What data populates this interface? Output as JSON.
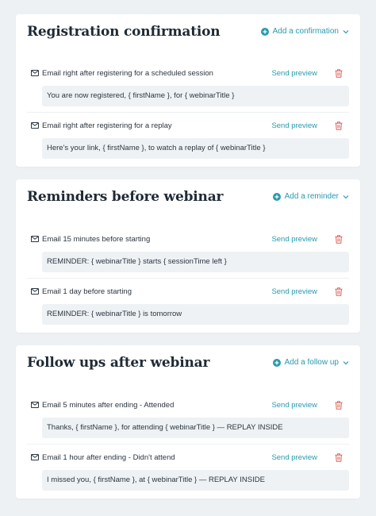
{
  "sections": [
    {
      "title": "Registration confirmation",
      "add_label": "Add a confirmation",
      "emails": [
        {
          "label": "Email right after registering for a scheduled session",
          "preview": "Send preview",
          "subject": "You are now registered, { firstName }, for { webinarTitle }"
        },
        {
          "label": "Email right after registering for a replay",
          "preview": "Send preview",
          "subject": "Here's your link, { firstName }, to watch a replay of { webinarTitle }"
        }
      ]
    },
    {
      "title": "Reminders before webinar",
      "add_label": "Add a reminder",
      "emails": [
        {
          "label": "Email 15 minutes before starting",
          "preview": "Send preview",
          "subject": "REMINDER: { webinarTitle } starts { sessionTime left }"
        },
        {
          "label": "Email 1 day before starting",
          "preview": "Send preview",
          "subject": "REMINDER: { webinarTitle } is tomorrow"
        }
      ]
    },
    {
      "title": "Follow ups after webinar",
      "add_label": "Add a follow up",
      "emails": [
        {
          "label": "Email 5 minutes after ending - Attended",
          "preview": "Send preview",
          "subject": "Thanks, { firstName }, for attending { webinarTitle } — REPLAY INSIDE"
        },
        {
          "label": "Email 1 hour after ending - Didn't attend",
          "preview": "Send preview",
          "subject": "I missed you, { firstName }, at { webinarTitle } — REPLAY INSIDE"
        }
      ]
    }
  ],
  "colors": {
    "accent": "#2a9ab0",
    "delete": "#e0625a",
    "background": "#eef1f4",
    "field": "#eef2f5"
  },
  "icons": {
    "add": "plus-circle-icon",
    "dropdown": "chevron-down-icon",
    "email": "mail-icon",
    "delete": "trash-icon"
  }
}
